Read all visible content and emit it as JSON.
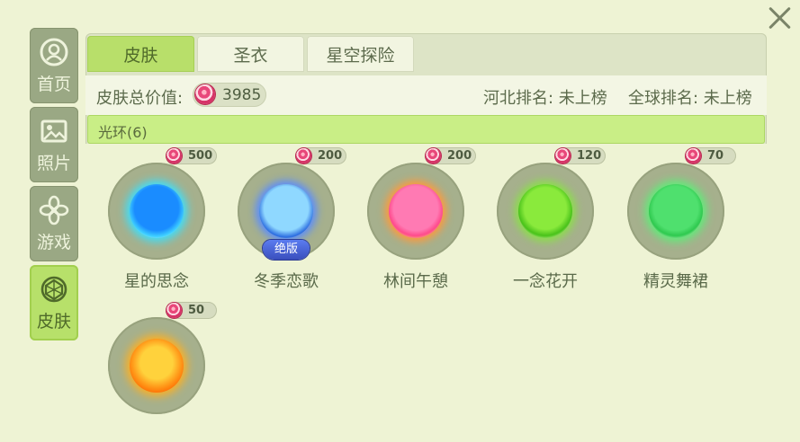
{
  "sidebar": {
    "items": [
      {
        "label": "首页",
        "icon": "avatar-icon",
        "active": false
      },
      {
        "label": "照片",
        "icon": "photo-icon",
        "active": false
      },
      {
        "label": "游戏",
        "icon": "flower-icon",
        "active": false
      },
      {
        "label": "皮肤",
        "icon": "skin-icon",
        "active": true
      }
    ]
  },
  "tabs": [
    {
      "label": "皮肤",
      "active": true
    },
    {
      "label": "圣衣",
      "active": false
    },
    {
      "label": "星空探险",
      "active": false
    }
  ],
  "summary": {
    "total_label": "皮肤总价值:",
    "total_value": "3985",
    "province_rank": "河北排名: 未上榜",
    "global_rank": "全球排名: 未上榜"
  },
  "section": {
    "title": "光环(6)"
  },
  "items": [
    {
      "name": "星的思念",
      "price": "500",
      "orb": "blue",
      "badge": ""
    },
    {
      "name": "冬季恋歌",
      "price": "200",
      "orb": "ice",
      "badge": "绝版"
    },
    {
      "name": "林间午憩",
      "price": "200",
      "orb": "pink",
      "badge": ""
    },
    {
      "name": "一念花开",
      "price": "120",
      "orb": "green",
      "badge": ""
    },
    {
      "name": "精灵舞裙",
      "price": "70",
      "orb": "mint",
      "badge": ""
    },
    {
      "name": "",
      "price": "50",
      "orb": "orange",
      "badge": ""
    }
  ],
  "colors": {
    "active_green": "#b8df6a",
    "sidebar_inactive": "#9aa884",
    "panel_bg": "#dde4c6",
    "candy_pink": "#e8477a"
  }
}
